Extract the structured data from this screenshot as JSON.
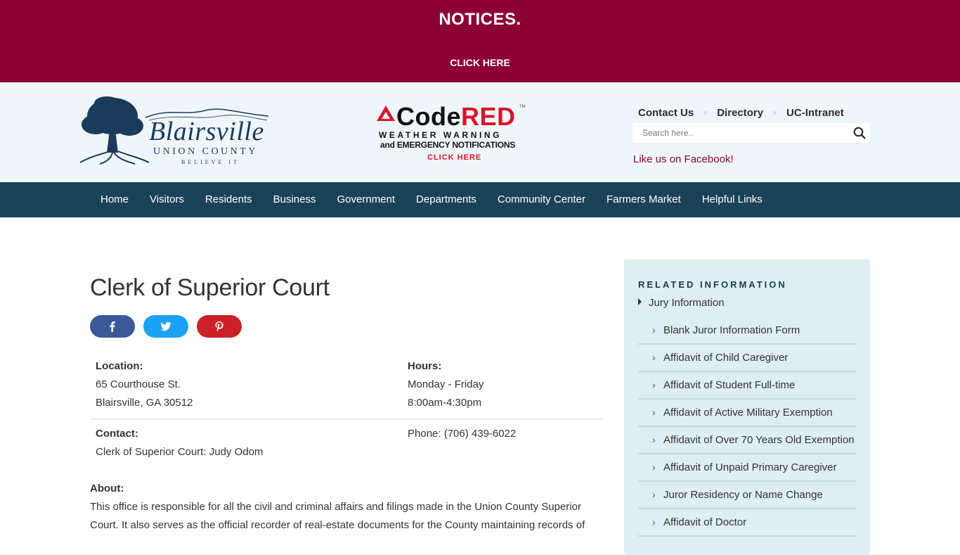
{
  "alert": {
    "title": "NOTICES.",
    "cta": "CLICK HERE"
  },
  "logo": {
    "wordmark": "Blairsville",
    "county": "UNION COUNTY",
    "tagline": "BELIEVE IT"
  },
  "codered": {
    "brand_code": "Code",
    "brand_red": "RED",
    "tm": "TM",
    "line1": "WEATHER WARNING",
    "line2": "and EMERGENCY NOTIFICATIONS",
    "line3": "CLICK HERE"
  },
  "utility": {
    "contact": "Contact Us",
    "directory": "Directory",
    "intranet": "UC-Intranet"
  },
  "search": {
    "placeholder": "Search here.."
  },
  "facebook": "Like us on Facebook!",
  "nav": [
    "Home",
    "Visitors",
    "Residents",
    "Business",
    "Government",
    "Departments",
    "Community Center",
    "Farmers Market",
    "Helpful Links"
  ],
  "page": {
    "title": "Clerk of Superior Court"
  },
  "info": {
    "location_label": "Location:",
    "location_line1": "65 Courthouse St.",
    "location_line2": "Blairsville, GA 30512",
    "hours_label": "Hours:",
    "hours_line1": "Monday - Friday",
    "hours_line2": "8:00am-4:30pm",
    "contact_label": "Contact:",
    "contact_value": "Clerk of Superior Court: Judy Odom",
    "phone": "Phone: (706) 439-6022"
  },
  "about": {
    "label": "About:",
    "text": "This office is responsible for all the civil and criminal affairs and filings made in the Union County Superior Court. It also serves as the official recorder of real-estate documents for the County maintaining records of"
  },
  "sidebar": {
    "heading": "RELATED INFORMATION",
    "parent": "Jury Information",
    "items": [
      "Blank Juror Information Form",
      "Affidavit of Child Caregiver",
      "Affidavit of Student Full-time",
      "Affidavit of Active Military Exemption",
      "Affidavit of Over 70 Years Old Exemption",
      "Affidavit of Unpaid Primary Caregiver",
      "Juror Residency or Name Change",
      "Affidavit of Doctor"
    ]
  },
  "colors": {
    "alert_bg": "#8c0234",
    "nav_bg": "#1c4259",
    "header_bg": "#eff6f9",
    "sidebar_bg": "#deeef2",
    "accent_red": "#d8152c"
  }
}
